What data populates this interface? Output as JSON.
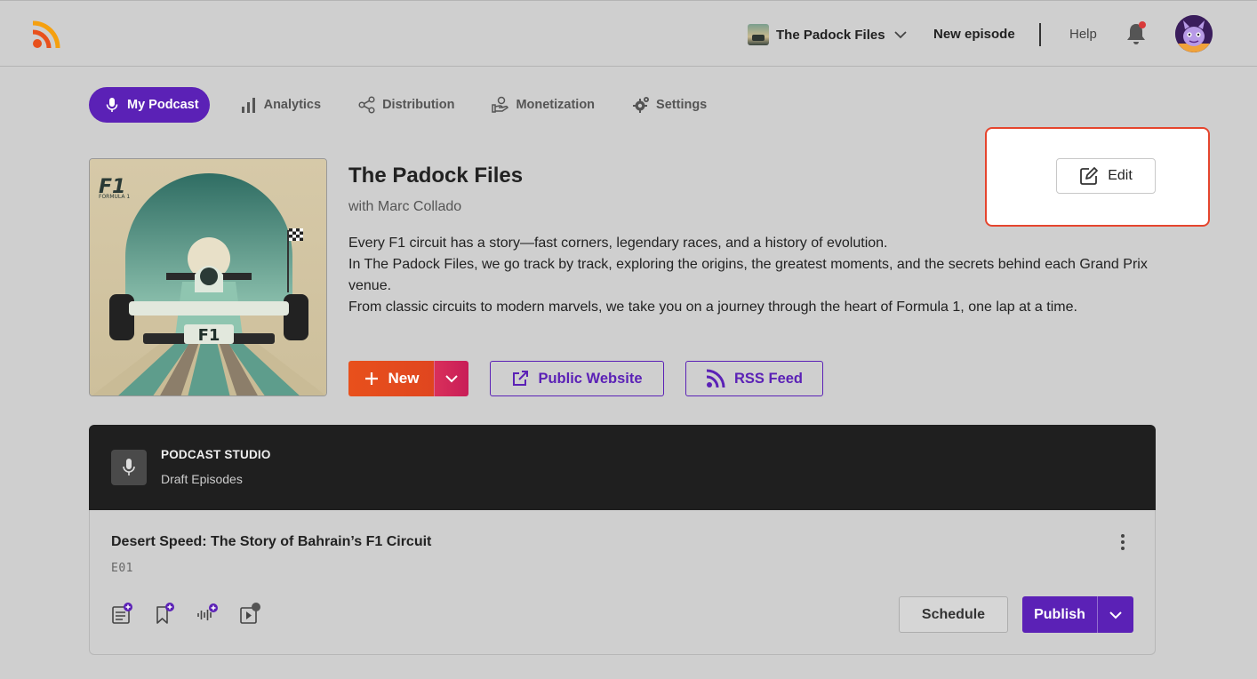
{
  "header": {
    "logo_icon": "rss-logo-icon",
    "podcast_switcher": {
      "name": "The Padock Files",
      "icon": "chevron-down-icon"
    },
    "new_episode_label": "New episode",
    "help_label": "Help",
    "notifications": {
      "icon": "bell-icon",
      "has_unread": true
    },
    "avatar_icon": "user-avatar"
  },
  "tabs": [
    {
      "label": "My Podcast",
      "icon": "microphone-icon",
      "active": true
    },
    {
      "label": "Analytics",
      "icon": "bar-chart-icon",
      "active": false
    },
    {
      "label": "Distribution",
      "icon": "share-icon",
      "active": false
    },
    {
      "label": "Monetization",
      "icon": "hand-coin-icon",
      "active": false
    },
    {
      "label": "Settings",
      "icon": "gear-icon",
      "active": false
    }
  ],
  "podcast": {
    "cover_text": "FORMULA 1",
    "title": "The Padock Files",
    "author": "with Marc Collado",
    "description": [
      "Every F1 circuit has a story—fast corners, legendary races, and a history of evolution.",
      "In The Padock Files, we go track by track, exploring the origins, the greatest moments, and the secrets behind each Grand Prix venue.",
      "From classic circuits to modern marvels, we take you on a journey through the heart of Formula 1, one lap at a time."
    ],
    "edit_label": "Edit"
  },
  "actions": {
    "new_label": "New",
    "public_website_label": "Public Website",
    "rss_feed_label": "RSS Feed"
  },
  "studio": {
    "title": "PODCAST STUDIO",
    "subtitle": "Draft Episodes"
  },
  "episode": {
    "title": "Desert Speed: The Story of Bahrain’s F1 Circuit",
    "code": "E01",
    "tools": [
      "add-notes-icon",
      "add-bookmark-icon",
      "add-audio-icon",
      "add-video-icon"
    ],
    "schedule_label": "Schedule",
    "publish_label": "Publish"
  },
  "colors": {
    "brand_purple": "#5b21b6",
    "accent_orange": "#e8501c",
    "accent_pink": "#c81d58",
    "highlight_red": "#e5452e",
    "background": "#cfcfcf",
    "studio_header": "#1f1f1f"
  }
}
